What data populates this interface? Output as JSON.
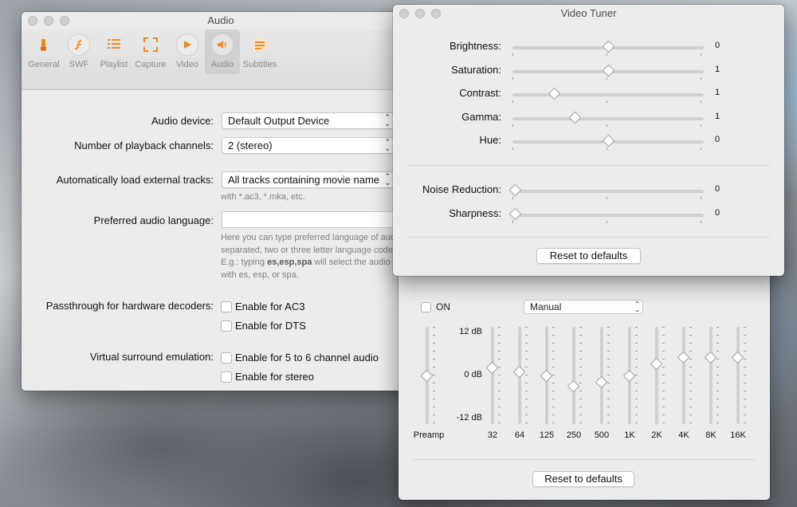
{
  "audio_window": {
    "title": "Audio",
    "toolbar": [
      {
        "label": "General",
        "icon": "general-icon"
      },
      {
        "label": "SWF",
        "icon": "swf-icon"
      },
      {
        "label": "Playlist",
        "icon": "playlist-icon"
      },
      {
        "label": "Capture",
        "icon": "capture-icon"
      },
      {
        "label": "Video",
        "icon": "video-icon"
      },
      {
        "label": "Audio",
        "icon": "audio-icon",
        "active": true
      },
      {
        "label": "Subtitles",
        "icon": "subtitles-icon"
      }
    ],
    "audio_device": {
      "label": "Audio device:",
      "value": "Default Output Device"
    },
    "channels": {
      "label": "Number of playback channels:",
      "value": "2 (stereo)"
    },
    "external_tracks": {
      "label": "Automatically load external tracks:",
      "value": "All tracks containing movie name",
      "hint": "with *.ac3, *.mka, etc."
    },
    "preferred_language": {
      "label": "Preferred audio language:",
      "value": "",
      "hint_line1": "Here you can type preferred language of aud",
      "hint_line2": "separated, two or three letter language code",
      "hint_line3_pre": "E.g.: typing ",
      "hint_line3_bold": "es,esp,spa",
      "hint_line3_post": " will select the audio t",
      "hint_line4": "with es, esp, or spa."
    },
    "passthrough": {
      "label": "Passthrough for hardware decoders:",
      "ac3": "Enable for AC3",
      "dts": "Enable for DTS"
    },
    "surround": {
      "label": "Virtual surround emulation:",
      "five_six": "Enable for 5 to 6 channel audio",
      "stereo": "Enable for stereo"
    }
  },
  "equalizer_window": {
    "on_label": "ON",
    "on_checked": false,
    "preset": "Manual",
    "db_top": "12 dB",
    "db_mid": "0 dB",
    "db_bottom": "-12 dB",
    "preamp_label": "Preamp",
    "preamp_value": 0,
    "bands": [
      {
        "label": "32",
        "value": 2
      },
      {
        "label": "64",
        "value": 1
      },
      {
        "label": "125",
        "value": 0
      },
      {
        "label": "250",
        "value": -2.5
      },
      {
        "label": "500",
        "value": -1.5
      },
      {
        "label": "1K",
        "value": 0
      },
      {
        "label": "2K",
        "value": 3
      },
      {
        "label": "4K",
        "value": 4.5
      },
      {
        "label": "8K",
        "value": 4.5
      },
      {
        "label": "16K",
        "value": 4.5
      }
    ],
    "reset_label": "Reset to defaults"
  },
  "video_tuner": {
    "title": "Video Tuner",
    "sliders": [
      {
        "label": "Brightness:",
        "value": "0",
        "position": 0.5
      },
      {
        "label": "Saturation:",
        "value": "1",
        "position": 0.5
      },
      {
        "label": "Contrast:",
        "value": "1",
        "position": 0.21
      },
      {
        "label": "Gamma:",
        "value": "1",
        "position": 0.32
      },
      {
        "label": "Hue:",
        "value": "0",
        "position": 0.5
      }
    ],
    "sliders2": [
      {
        "label": "Noise Reduction:",
        "value": "0",
        "position": 0.0
      },
      {
        "label": "Sharpness:",
        "value": "0",
        "position": 0.0
      }
    ],
    "reset_label": "Reset to defaults"
  }
}
